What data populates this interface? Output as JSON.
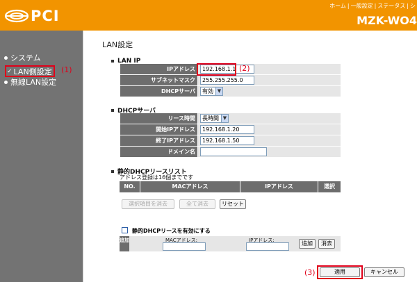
{
  "header": {
    "logo_text": "PCI",
    "nav": [
      "ホーム",
      "一般設定",
      "ステータス",
      "シ"
    ],
    "product": "MZK-WO4"
  },
  "sidebar": {
    "items": [
      {
        "label": "システム"
      },
      {
        "label": "LAN側設定"
      },
      {
        "label": "無線LAN設定"
      }
    ],
    "annotation": "(1)"
  },
  "page": {
    "title": "LAN設定"
  },
  "lan_ip": {
    "title": "LAN IP",
    "ip_label": "IPアドレス",
    "ip_value": "192.168.1.1",
    "subnet_label": "サブネットマスク",
    "subnet_value": "255.255.255.0",
    "dhcp_label": "DHCPサーバ",
    "dhcp_value": "有効",
    "annotation": "(2)"
  },
  "dhcp": {
    "title": "DHCPサーバ",
    "lease_label": "リース時間",
    "lease_value": "長時間",
    "start_label": "開始IPアドレス",
    "start_value": "192.168.1.20",
    "end_label": "終了IPアドレス",
    "end_value": "192.168.1.50",
    "domain_label": "ドメイン名",
    "domain_value": ""
  },
  "static_list": {
    "title": "静的DHCPリースリスト",
    "note": "アドレス登録は16個までです",
    "columns": [
      "NO.",
      "MACアドレス",
      "IPアドレス",
      "選択"
    ],
    "btn_delete_selected": "選択項目を消去",
    "btn_delete_all": "全て消去",
    "btn_reset": "リセット"
  },
  "static_enable": {
    "label": "静的DHCPリースを有効にする",
    "add_label": "追加",
    "mac_caption": "MACアドレス:",
    "ip_caption": "IPアドレス:",
    "btn_add": "追加",
    "btn_clear": "消去"
  },
  "footer": {
    "apply": "適用",
    "cancel": "キャンセル",
    "annotation": "(3)"
  },
  "colors": {
    "header": "#f29400",
    "sidebar": "#737373",
    "annotation": "#e0001a"
  }
}
